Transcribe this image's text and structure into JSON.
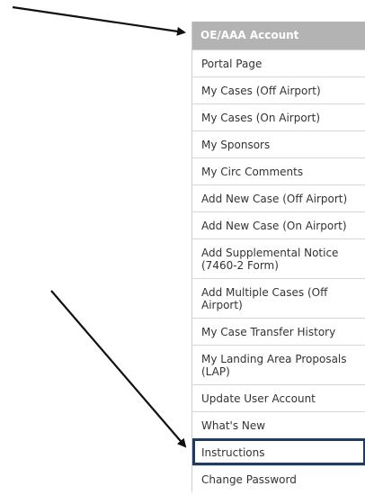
{
  "menu": {
    "header": "OE/AAA Account",
    "items": [
      {
        "label": "Portal Page"
      },
      {
        "label": "My Cases (Off Airport)"
      },
      {
        "label": "My Cases (On Airport)"
      },
      {
        "label": "My Sponsors"
      },
      {
        "label": "My Circ Comments"
      },
      {
        "label": "Add New Case (Off Airport)"
      },
      {
        "label": "Add New Case (On Airport)"
      },
      {
        "label": "Add Supplemental Notice (7460-2 Form)"
      },
      {
        "label": "Add Multiple Cases (Off Airport)"
      },
      {
        "label": "My Case Transfer History"
      },
      {
        "label": "My Landing Area Proposals (LAP)"
      },
      {
        "label": "Update User Account"
      },
      {
        "label": "What's New"
      },
      {
        "label": "Instructions"
      },
      {
        "label": "Change Password"
      }
    ]
  },
  "annotation": {
    "arrow_color": "#111111",
    "highlight_color": "#1f3a66"
  }
}
